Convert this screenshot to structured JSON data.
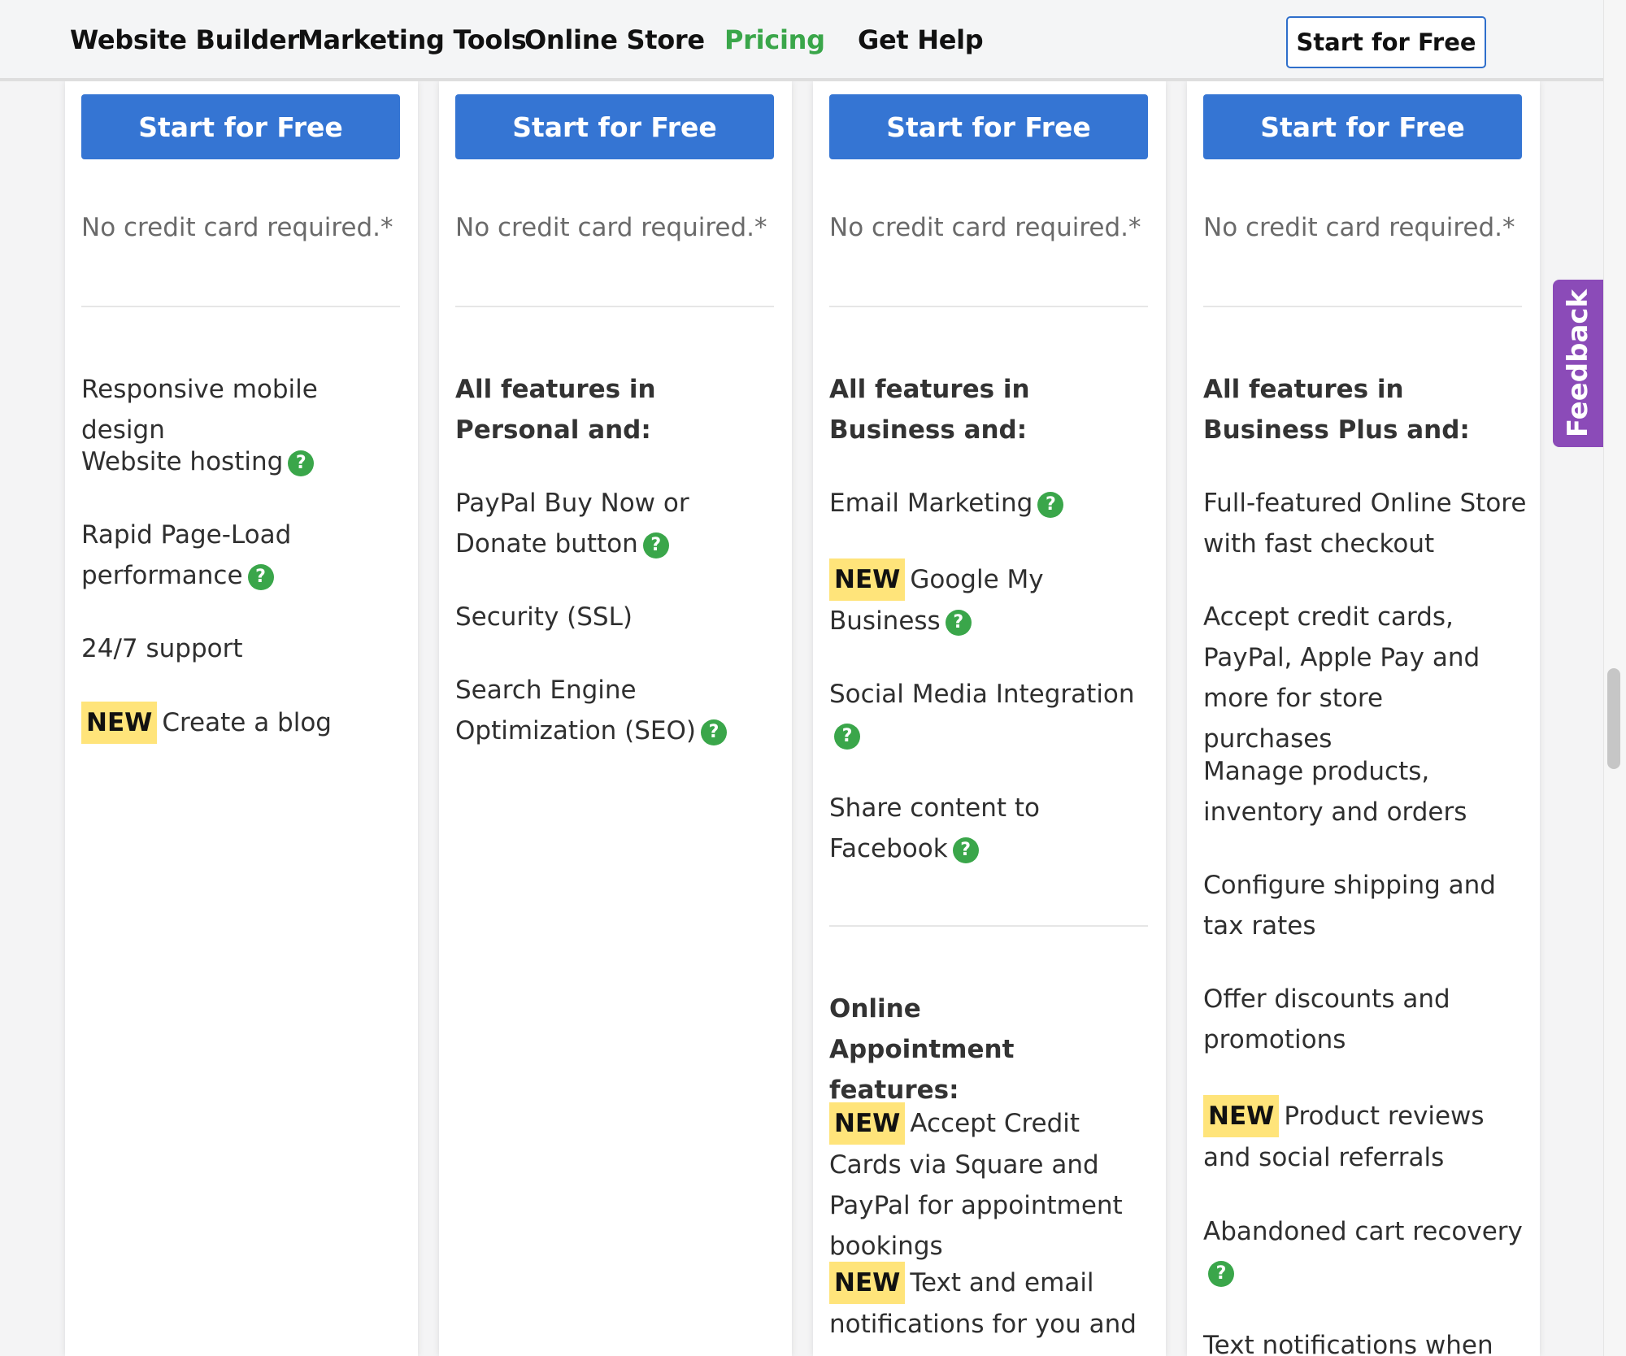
{
  "nav": {
    "items": [
      "Website Builder",
      "Marketing Tools",
      "Online Store",
      "Pricing",
      "Get Help"
    ],
    "active": "Pricing",
    "cta": "Start for Free"
  },
  "plans": [
    {
      "cta": "Start for Free",
      "note": "No credit card required.*",
      "features": [
        {
          "text": "Responsive mobile design"
        },
        {
          "text": "Website hosting",
          "help": true
        },
        {
          "text": "Rapid Page-Load performance",
          "help": true
        },
        {
          "text": "24/7 support"
        },
        {
          "text": "Create a blog",
          "badge": "NEW"
        }
      ]
    },
    {
      "cta": "Start for Free",
      "note": "No credit card required.*",
      "features": [
        {
          "text": "All features in Personal and:",
          "heading": true
        },
        {
          "text": "PayPal Buy Now or Donate button",
          "help": true
        },
        {
          "text": "Security (SSL)"
        },
        {
          "text": "Search Engine Optimization (SEO)",
          "help": true
        }
      ]
    },
    {
      "cta": "Start for Free",
      "note": "No credit card required.*",
      "features": [
        {
          "text": "All features in Business and:",
          "heading": true
        },
        {
          "text": "Email Marketing",
          "help": true
        },
        {
          "text": "Google My Business",
          "badge": "NEW",
          "help": true
        },
        {
          "text": "Social Media Integration",
          "help": true
        },
        {
          "text": "Share content to Facebook",
          "help": true
        }
      ],
      "appointment": {
        "heading": "Online Appointment features:",
        "features": [
          {
            "text": "Accept Credit Cards via Square and PayPal for appointment bookings",
            "badge": "NEW"
          },
          {
            "text": "Text and email notifications for you and",
            "badge": "NEW"
          }
        ]
      }
    },
    {
      "cta": "Start for Free",
      "note": "No credit card required.*",
      "features": [
        {
          "text": "All features in Business Plus and:",
          "heading": true
        },
        {
          "text": "Full-featured Online Store with fast checkout"
        },
        {
          "text": "Accept credit cards, PayPal, Apple Pay and more for store purchases"
        },
        {
          "text": "Manage products, inventory and orders"
        },
        {
          "text": "Configure shipping and tax rates"
        },
        {
          "text": "Offer discounts and promotions"
        },
        {
          "text": "Product reviews and social referrals",
          "badge": "NEW"
        },
        {
          "text": "Abandoned cart recovery",
          "help": true
        },
        {
          "text": "Text notifications when"
        }
      ]
    }
  ],
  "help_glyph": "?",
  "feedback": "Feedback",
  "colors": {
    "primary": "#3575d3",
    "accent_green": "#3aa64a",
    "badge": "#ffe47a",
    "feedback": "#8b4bb8"
  }
}
